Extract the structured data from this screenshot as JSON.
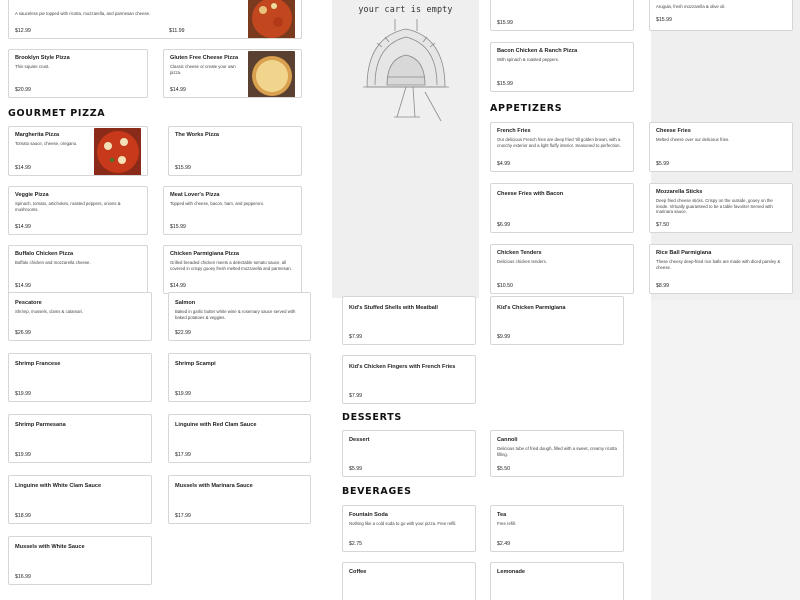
{
  "cart": {
    "title": "your cart is empty"
  },
  "sections": {
    "gourmet": "GOURMET PIZZA",
    "appetizers": "APPETIZERS",
    "desserts": "DESSERTS",
    "beverages": "BEVERAGES"
  },
  "items": {
    "white_pizza": {
      "desc": "A sauceless pie topped with ricotta, mozzarella, and parmesan cheese.",
      "price": "$12.99"
    },
    "italian_tomato_pie": {
      "price": "$11.99"
    },
    "top_col3": {
      "price": "$15.99"
    },
    "top_col4": {
      "desc": "Arugula, fresh mozzarella & olive oil.",
      "price": "$15.99"
    },
    "brooklyn": {
      "name": "Brooklyn Style Pizza",
      "desc": "Thin square crust.",
      "price": "$20.99"
    },
    "gluten_free": {
      "name": "Gluten Free Cheese Pizza",
      "desc": "Classic cheese or create your own pizza.",
      "price": "$14.99"
    },
    "bacon_chicken_ranch": {
      "name": "Bacon Chicken & Ranch Pizza",
      "desc": "With spinach & roasted peppers.",
      "price": "$15.99"
    },
    "margherita": {
      "name": "Margherita Pizza",
      "desc": "Tomato sauce, cheese, oregano.",
      "price": "$14.99"
    },
    "works": {
      "name": "The Works Pizza",
      "price": "$15.99"
    },
    "french_fries": {
      "name": "French Fries",
      "desc": "Our delicious French fries are deep fried 'till golden brown, with a crunchy exterior and a light fluffy interior. Seasoned to perfection.",
      "price": "$4.99"
    },
    "cheese_fries": {
      "name": "Cheese Fries",
      "desc": "Melted cheese over our delicious fries.",
      "price": "$5.99"
    },
    "veggie": {
      "name": "Veggie Pizza",
      "desc": "Spinach, tomato, artichokes, roasted peppers, onions & mushrooms.",
      "price": "$14.99"
    },
    "meat_lovers": {
      "name": "Meat Lover's Pizza",
      "desc": "Topped with cheese, bacon, ham, and pepperoni.",
      "price": "$15.99"
    },
    "cheese_fries_bacon": {
      "name": "Cheese Fries with Bacon",
      "price": "$6.99"
    },
    "mozz_sticks": {
      "name": "Mozzarella Sticks",
      "desc": "Deep fried cheese sticks. Crispy on the outside, gooey on the inside. Virtually guaranteed to be a table favorite! Served with marinara sauce.",
      "price": "$7.50"
    },
    "buffalo_chicken": {
      "name": "Buffalo Chicken Pizza",
      "desc": "Buffalo chicken and mozzarella cheese.",
      "price": "$14.99"
    },
    "chicken_parm_pizza": {
      "name": "Chicken Parmigiana Pizza",
      "desc": "Grilled breaded chicken meets a delectable tomato sauce, all covered in crispy gooey fresh melted mozzarella and parmesan.",
      "price": "$14.99"
    },
    "chicken_tenders": {
      "name": "Chicken Tenders",
      "desc": "Delicious chicken tenders.",
      "price": "$10.50"
    },
    "rice_ball": {
      "name": "Rice Ball Parmigiana",
      "desc": "These cheesy deep-fried rice balls are made with diced parsley & cheese.",
      "price": "$8.99"
    },
    "pescatore": {
      "name": "Pescatore",
      "desc": "Shrimp, mussels, clams & calamari.",
      "price": "$26.99"
    },
    "salmon": {
      "name": "Salmon",
      "desc": "Baked in garlic butter white wine & rosemary sauce served with baked potatoes & veggies.",
      "price": "$22.99"
    },
    "kids_stuffed_shells": {
      "name": "Kid's Stuffed Shells with Meatball",
      "price": "$7.99"
    },
    "kids_chicken_parm": {
      "name": "Kid's Chicken Parmigiana",
      "price": "$9.99"
    },
    "shrimp_francese": {
      "name": "Shrimp Francese",
      "price": "$19.99"
    },
    "shrimp_scampi": {
      "name": "Shrimp Scampi",
      "price": "$19.99"
    },
    "kids_chicken_fingers": {
      "name": "Kid's Chicken Fingers with French Fries",
      "price": "$7.99"
    },
    "shrimp_parmesana": {
      "name": "Shrimp Parmesana",
      "price": "$19.99"
    },
    "linguine_red_clam": {
      "name": "Linguine with Red Clam Sauce",
      "price": "$17.99"
    },
    "dessert": {
      "name": "Dessert",
      "price": "$5.99"
    },
    "cannoli": {
      "name": "Cannoli",
      "desc": "Delicious tube of fried dough, filled with a sweet, creamy ricotta filling.",
      "price": "$5.50"
    },
    "linguine_white_clam": {
      "name": "Linguine with White Clam Sauce",
      "price": "$18.99"
    },
    "mussels_marinara": {
      "name": "Mussels with Marinara Sauce",
      "price": "$17.99"
    },
    "fountain_soda": {
      "name": "Fountain Soda",
      "desc": "Nothing like a cold soda to go with your pizza. Free refill.",
      "price": "$2.75"
    },
    "tea": {
      "name": "Tea",
      "desc": "Free refill.",
      "price": "$2.49"
    },
    "mussels_white": {
      "name": "Mussels with White Sauce",
      "price": "$16.99"
    },
    "coffee": {
      "name": "Coffee"
    },
    "lemonade": {
      "name": "Lemonade"
    }
  },
  "colors": {
    "card_border": "#d6d6d6",
    "panel_bg": "#efefef",
    "text": "#222222"
  }
}
